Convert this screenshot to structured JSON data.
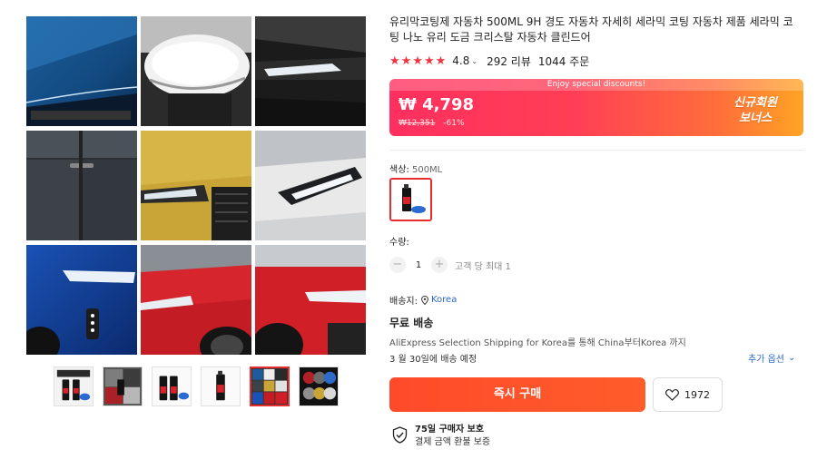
{
  "product": {
    "title": "유리막코팅제 자동차 500ML 9H 경도 자동차 자세히 세라믹 코팅 자동차 제품 세라믹 코팅 나노 유리 도금 크리스탈 자동차 클린드어",
    "rating": {
      "stars_icon": "★★★★★",
      "score": "4.8",
      "chevron": "⌄",
      "reviews": "292 리뷰",
      "orders": "1044 주문",
      "star_color": "#f5333f"
    },
    "price": {
      "banner_text": "Enjoy special discounts!",
      "current": "₩ 4,798",
      "original": "₩12,351",
      "discount": "-61%",
      "bonus_line1": "신규회원",
      "bonus_line2": "보너스"
    },
    "color": {
      "label": "색상:",
      "value": "500ML"
    },
    "quantity": {
      "label": "수량:",
      "minus": "−",
      "value": "1",
      "plus": "+",
      "limit": "고객 당 최대 1"
    },
    "shipping": {
      "label": "배송지:",
      "location": "Korea",
      "location_icon": "location-pin-icon",
      "free": "무료 배송",
      "description": "AliExpress Selection Shipping for Korea를 통해 China부터Korea 까지",
      "date": "3 월 30일에 배송 예정",
      "more_options": "추가 옵션",
      "more_chevron": "⌄"
    },
    "actions": {
      "buy_now": "즉시 구매",
      "wishlist_count": "1972",
      "wishlist_icon": "heart-icon"
    },
    "protection": {
      "title": "75일 구매자 보호",
      "subtitle": "결제 금액 환불 보증",
      "icon": "shield-check-icon"
    }
  },
  "gallery": {
    "tiles": [
      "car-hood-blue",
      "side-mirror-white",
      "headlight-black",
      "car-door-dark",
      "car-front-yellow",
      "headlight-white",
      "headlight-blue",
      "car-front-red",
      "car-front-red-2"
    ],
    "thumbnails": [
      "product-bottles-1",
      "car-collage",
      "product-bottles-2",
      "product-bottle-single",
      "car-collage-active",
      "features-grid"
    ],
    "active_thumbnail": 4
  },
  "colors": {
    "accent": "#e62e2e",
    "buy_button": "#ff4f2a",
    "link": "#2b67c8"
  }
}
